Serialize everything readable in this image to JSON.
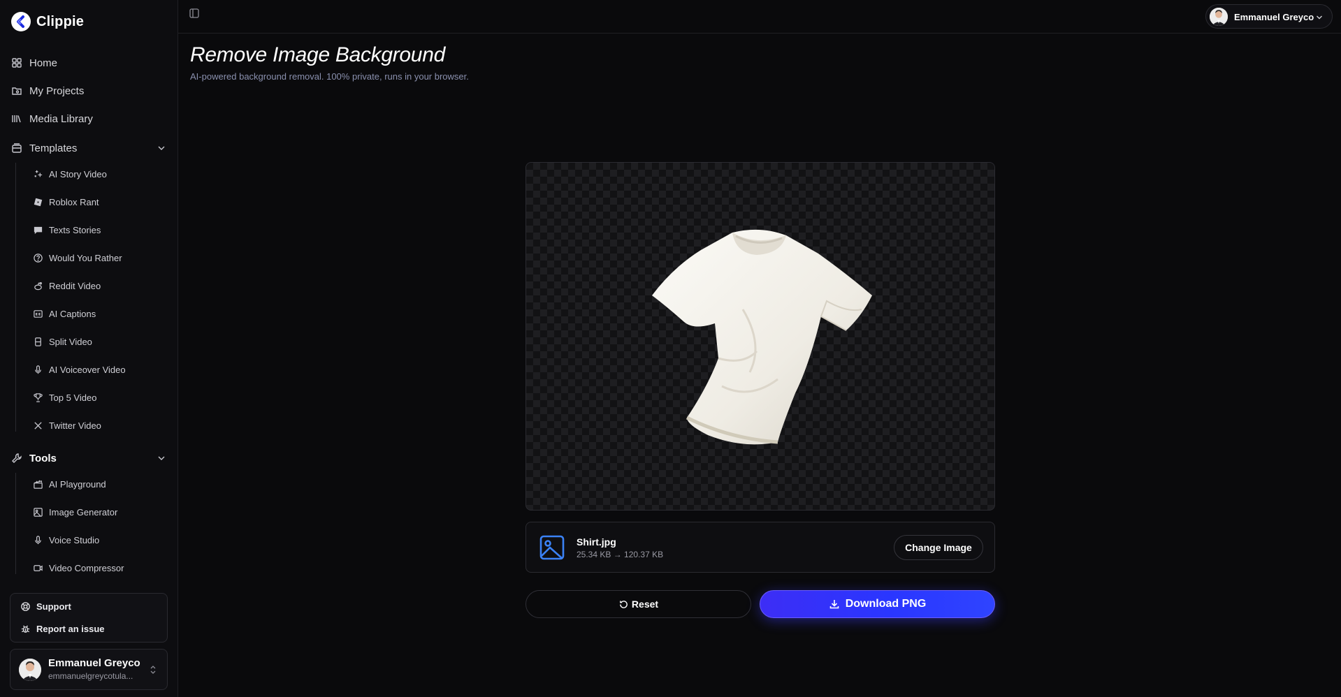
{
  "app": {
    "name": "Clippie"
  },
  "sidebar": {
    "nav": [
      {
        "label": "Home",
        "icon": "grid-icon"
      },
      {
        "label": "My Projects",
        "icon": "folder-icon"
      },
      {
        "label": "Media Library",
        "icon": "library-icon"
      }
    ],
    "templates": {
      "label": "Templates",
      "items": [
        {
          "label": "AI Story Video",
          "icon": "sparkles-icon"
        },
        {
          "label": "Roblox Rant",
          "icon": "roblox-icon"
        },
        {
          "label": "Texts Stories",
          "icon": "message-icon"
        },
        {
          "label": "Would You Rather",
          "icon": "question-icon"
        },
        {
          "label": "Reddit Video",
          "icon": "reddit-icon"
        },
        {
          "label": "AI Captions",
          "icon": "captions-icon"
        },
        {
          "label": "Split Video",
          "icon": "split-icon"
        },
        {
          "label": "AI Voiceover Video",
          "icon": "mic-icon"
        },
        {
          "label": "Top 5 Video",
          "icon": "trophy-icon"
        },
        {
          "label": "Twitter Video",
          "icon": "x-icon"
        }
      ]
    },
    "tools": {
      "label": "Tools",
      "items": [
        {
          "label": "AI Playground",
          "icon": "clapper-icon"
        },
        {
          "label": "Image Generator",
          "icon": "image-icon"
        },
        {
          "label": "Voice Studio",
          "icon": "mic-icon"
        },
        {
          "label": "Video Compressor",
          "icon": "video-icon"
        }
      ]
    },
    "support": {
      "support_label": "Support",
      "report_label": "Report an issue"
    },
    "user": {
      "name": "Emmanuel Greyco",
      "email": "emmanuelgreycotula..."
    }
  },
  "topbar": {
    "account_name": "Emmanuel Greyco"
  },
  "main": {
    "title": "Remove Image Background",
    "subtitle": "AI-powered background removal. 100% private, runs in your browser.",
    "file": {
      "name": "Shirt.jpg",
      "size": "25.34 KB → 120.37 KB"
    },
    "change_label": "Change Image",
    "reset_label": "Reset",
    "download_label": "Download PNG"
  },
  "colors": {
    "accent": "#2f3cff",
    "background": "#0a0a0c"
  }
}
